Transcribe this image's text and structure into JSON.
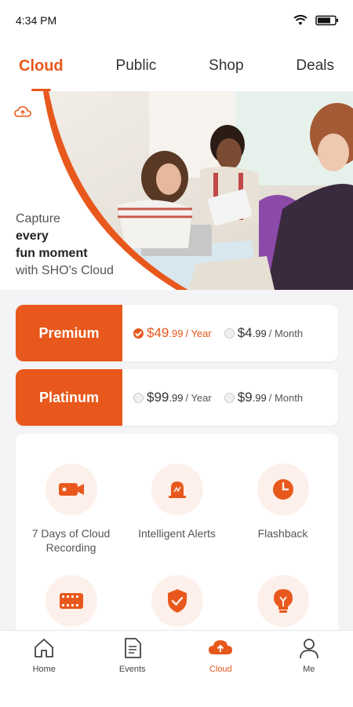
{
  "status_bar": {
    "time": "4:34 PM",
    "icons": [
      "wifi-icon",
      "battery-icon"
    ]
  },
  "tabs": [
    {
      "label": "Cloud",
      "active": true
    },
    {
      "label": "Public",
      "active": false
    },
    {
      "label": "Shop",
      "active": false
    },
    {
      "label": "Deals",
      "active": false
    }
  ],
  "hero": {
    "line1": "Capture",
    "line2": "every",
    "line3": "fun moment",
    "line4": "with SHO's Cloud"
  },
  "plans": [
    {
      "name": "Premium",
      "options": [
        {
          "price": "$49",
          "cents": ".99",
          "period": "/ Year",
          "selected": true
        },
        {
          "price": "$4",
          "cents": ".99",
          "period": "/ Month",
          "selected": false
        }
      ]
    },
    {
      "name": "Platinum",
      "options": [
        {
          "price": "$99",
          "cents": ".99",
          "period": "/ Year",
          "selected": false
        },
        {
          "price": "$9",
          "cents": ".99",
          "period": "/ Month",
          "selected": false
        }
      ]
    }
  ],
  "features": [
    {
      "label": "7 Days of Cloud Recording",
      "icon": "camera-icon"
    },
    {
      "label": "Intelligent Alerts",
      "icon": "alarm-icon"
    },
    {
      "label": "Flashback",
      "icon": "clock-icon"
    },
    {
      "label": "",
      "icon": "film-icon"
    },
    {
      "label": "",
      "icon": "shield-icon"
    },
    {
      "label": "",
      "icon": "lightbulb-icon"
    }
  ],
  "bottom_nav": [
    {
      "label": "Home",
      "icon": "home-icon",
      "active": false
    },
    {
      "label": "Events",
      "icon": "events-icon",
      "active": false
    },
    {
      "label": "Cloud",
      "icon": "cloud-icon",
      "active": true
    },
    {
      "label": "Me",
      "icon": "profile-icon",
      "active": false
    }
  ],
  "colors": {
    "accent": "#e8581c",
    "accent_light": "#fdf0ea",
    "background": "#f4f4f6"
  }
}
